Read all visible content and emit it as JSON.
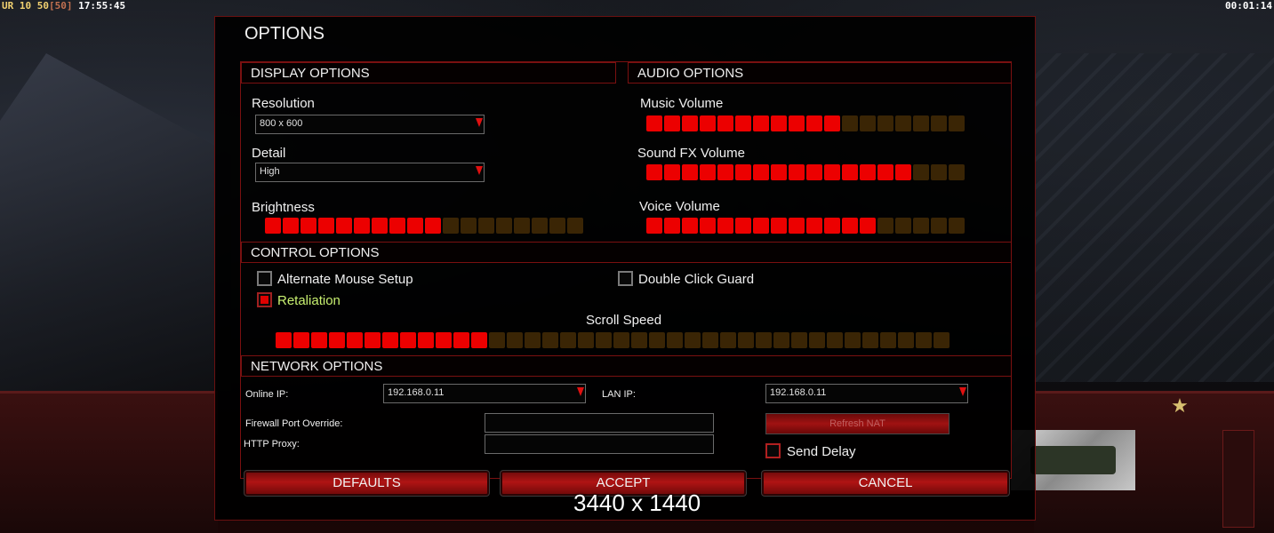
{
  "hud": {
    "stats": {
      "a": "UR",
      "b": "10",
      "c": "50",
      "d": "[50]",
      "e": "17:55:45"
    },
    "timer": "00:01:14"
  },
  "dialog": {
    "title": "OPTIONS"
  },
  "display": {
    "heading": "DISPLAY OPTIONS",
    "resolution_label": "Resolution",
    "resolution_value": "800 x 600",
    "detail_label": "Detail",
    "detail_value": "High",
    "brightness_label": "Brightness",
    "brightness_level": {
      "filled": 10,
      "total": 18
    }
  },
  "audio": {
    "heading": "AUDIO OPTIONS",
    "music_label": "Music Volume",
    "music_level": {
      "filled": 11,
      "total": 18
    },
    "sfx_label": "Sound FX Volume",
    "sfx_level": {
      "filled": 15,
      "total": 18
    },
    "voice_label": "Voice Volume",
    "voice_level": {
      "filled": 13,
      "total": 18
    }
  },
  "control": {
    "heading": "CONTROL OPTIONS",
    "alt_mouse_label": "Alternate Mouse Setup",
    "alt_mouse_checked": false,
    "double_click_label": "Double Click Guard",
    "double_click_checked": false,
    "retaliation_label": "Retaliation",
    "retaliation_checked": true,
    "scroll_label": "Scroll Speed",
    "scroll_level": {
      "filled": 12,
      "total": 38
    }
  },
  "network": {
    "heading": "NETWORK OPTIONS",
    "online_ip_label": "Online IP:",
    "online_ip_value": "192.168.0.11",
    "lan_ip_label": "LAN IP:",
    "lan_ip_value": "192.168.0.11",
    "firewall_label": "Firewall Port Override:",
    "firewall_value": "",
    "proxy_label": "HTTP Proxy:",
    "proxy_value": "",
    "refresh_nat_label": "Refresh NAT",
    "send_delay_label": "Send Delay",
    "send_delay_checked": false
  },
  "buttons": {
    "defaults": "DEFAULTS",
    "accept": "ACCEPT",
    "cancel": "CANCEL"
  },
  "overlay": {
    "resolution_text": "3440 x 1440"
  },
  "colors": {
    "accent": "#ec0000",
    "bar_off": "#3a2505",
    "frame": "#7a1010",
    "retaliation_text": "#c8f070"
  }
}
